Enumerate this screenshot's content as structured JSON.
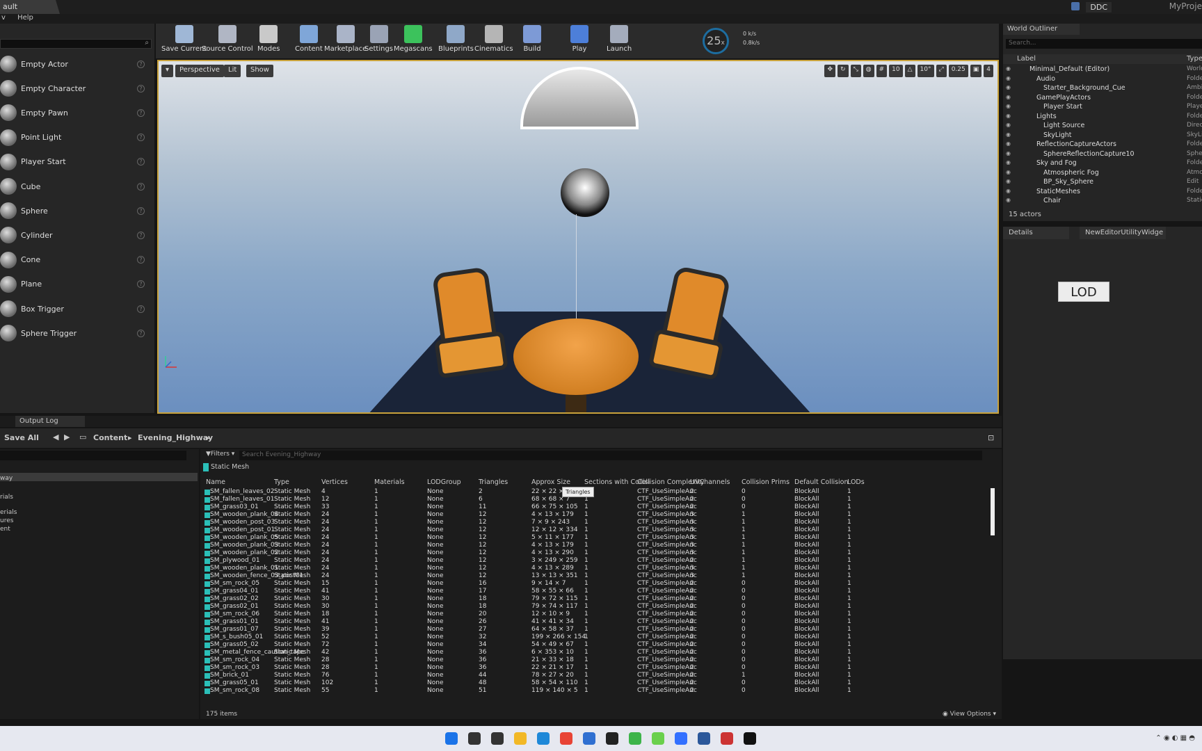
{
  "window": {
    "title_tab": "ault",
    "ddc_label": "DDC",
    "project_name": "MyProje"
  },
  "menu": {
    "items": [
      "v",
      "Help"
    ]
  },
  "place_items": [
    {
      "label": "Empty Actor",
      "icon": "sphere-icon"
    },
    {
      "label": "Empty Character",
      "icon": "character-icon"
    },
    {
      "label": "Empty Pawn",
      "icon": "pawn-icon"
    },
    {
      "label": "Point Light",
      "icon": "bulb-icon"
    },
    {
      "label": "Player Start",
      "icon": "player-start-icon"
    },
    {
      "label": "Cube",
      "icon": "cube-icon"
    },
    {
      "label": "Sphere",
      "icon": "sphere-icon"
    },
    {
      "label": "Cylinder",
      "icon": "cylinder-icon"
    },
    {
      "label": "Cone",
      "icon": "cone-icon"
    },
    {
      "label": "Plane",
      "icon": "plane-icon"
    },
    {
      "label": "Box Trigger",
      "icon": "box-trigger-icon"
    },
    {
      "label": "Sphere Trigger",
      "icon": "sphere-trigger-icon"
    }
  ],
  "toolbar": {
    "buttons": [
      {
        "label": "Save Current",
        "color": "#9fb7d6"
      },
      {
        "label": "Source Control",
        "color": "#b0b6c4"
      },
      {
        "label": "Modes",
        "color": "#c9c9c9"
      },
      {
        "label": "Content",
        "color": "#7fa6d8"
      },
      {
        "label": "Marketplace",
        "color": "#aab4c8"
      },
      {
        "label": "Settings",
        "color": "#9aa3b5"
      },
      {
        "label": "Megascans",
        "color": "#3cc25c"
      },
      {
        "label": "Blueprints",
        "color": "#8fa8c8"
      },
      {
        "label": "Cinematics",
        "color": "#b5b5b5"
      },
      {
        "label": "Build",
        "color": "#7d9ad6"
      },
      {
        "label": "Play",
        "color": "#4d7fd9"
      },
      {
        "label": "Launch",
        "color": "#a4acbc"
      }
    ],
    "fps": "25",
    "fps_unit": "x",
    "net_down": "0 k/s",
    "net_up": "0.8k/s"
  },
  "viewport": {
    "menu_label": "▾",
    "perspective": "Perspective",
    "lit": "Lit",
    "show": "Show",
    "grid_snap": "10",
    "rot_snap": "10°",
    "scale_snap": "0.25",
    "cam_speed": "4"
  },
  "outliner": {
    "tab": "World Outliner",
    "search_placeholder": "Search...",
    "col_label": "Label",
    "col_type": "Type",
    "rows": [
      {
        "label": "Minimal_Default (Editor)",
        "type": "World",
        "indent": 0
      },
      {
        "label": "Audio",
        "type": "Folder",
        "indent": 1
      },
      {
        "label": "Starter_Background_Cue",
        "type": "Ambi",
        "indent": 2
      },
      {
        "label": "GamePlayActors",
        "type": "Folder",
        "indent": 1
      },
      {
        "label": "Player Start",
        "type": "Playe",
        "indent": 2
      },
      {
        "label": "Lights",
        "type": "Folder",
        "indent": 1
      },
      {
        "label": "Light Source",
        "type": "Direc",
        "indent": 2
      },
      {
        "label": "SkyLight",
        "type": "SkyLi",
        "indent": 2
      },
      {
        "label": "ReflectionCaptureActors",
        "type": "Folder",
        "indent": 1
      },
      {
        "label": "SphereReflectionCapture10",
        "type": "Sphe",
        "indent": 2
      },
      {
        "label": "Sky and Fog",
        "type": "Folder",
        "indent": 1
      },
      {
        "label": "Atmospheric Fog",
        "type": "Atmo",
        "indent": 2
      },
      {
        "label": "BP_Sky_Sphere",
        "type": "Edit",
        "indent": 2
      },
      {
        "label": "StaticMeshes",
        "type": "Folder",
        "indent": 1
      },
      {
        "label": "Chair",
        "type": "Static",
        "indent": 2
      }
    ],
    "actor_count": "15 actors"
  },
  "details": {
    "tab": "Details",
    "tab2": "NewEditorUtilityWidge",
    "lod_button": "LOD"
  },
  "bottom": {
    "output_log_tab": "Output Log",
    "save_all": "Save All",
    "breadcrumb": [
      "Content",
      "Evening_Highway"
    ],
    "filters": "Filters",
    "search_placeholder": "Search Evening_Highway",
    "static_mesh_filter": "Static Mesh",
    "left_tree": [
      "way",
      "rials",
      "erials",
      "ures",
      "ent"
    ],
    "tooltip": "Triangles",
    "items_count": "175 items",
    "view_options": "View Options"
  },
  "table": {
    "columns": [
      "Name",
      "Type",
      "Vertices",
      "Materials",
      "LODGroup",
      "Triangles",
      "Approx Size",
      "Sections with Collisi",
      "Collision Complexity",
      "UVChannels",
      "Collision Prims",
      "Default Collision",
      "LODs"
    ],
    "rows": [
      [
        "SM_fallen_leaves_02",
        "Static Mesh",
        "4",
        "1",
        "None",
        "2",
        "22 × 22 × 3",
        "1",
        "CTF_UseSimpleAnc",
        "2",
        "0",
        "BlockAll",
        "1"
      ],
      [
        "SM_fallen_leaves_01",
        "Static Mesh",
        "12",
        "1",
        "None",
        "6",
        "68 × 68 × 7",
        "1",
        "CTF_UseSimpleAnc",
        "2",
        "0",
        "BlockAll",
        "1"
      ],
      [
        "SM_grass03_01",
        "Static Mesh",
        "33",
        "1",
        "None",
        "11",
        "66 × 75 × 105",
        "1",
        "CTF_UseSimpleAnc",
        "2",
        "0",
        "BlockAll",
        "1"
      ],
      [
        "SM_wooden_plank_04",
        "Static Mesh",
        "24",
        "1",
        "None",
        "12",
        "4 × 13 × 179",
        "1",
        "CTF_UseSimpleAnc",
        "3",
        "1",
        "BlockAll",
        "1"
      ],
      [
        "SM_wooden_post_03",
        "Static Mesh",
        "24",
        "1",
        "None",
        "12",
        "7 × 9 × 243",
        "1",
        "CTF_UseSimpleAnc",
        "3",
        "1",
        "BlockAll",
        "1"
      ],
      [
        "SM_wooden_post_01",
        "Static Mesh",
        "24",
        "1",
        "None",
        "12",
        "12 × 12 × 334",
        "1",
        "CTF_UseSimpleAnc",
        "3",
        "1",
        "BlockAll",
        "1"
      ],
      [
        "SM_wooden_plank_05",
        "Static Mesh",
        "24",
        "1",
        "None",
        "12",
        "5 × 11 × 177",
        "1",
        "CTF_UseSimpleAnc",
        "3",
        "1",
        "BlockAll",
        "1"
      ],
      [
        "SM_wooden_plank_03",
        "Static Mesh",
        "24",
        "1",
        "None",
        "12",
        "4 × 13 × 179",
        "1",
        "CTF_UseSimpleAnc",
        "3",
        "1",
        "BlockAll",
        "1"
      ],
      [
        "SM_wooden_plank_02",
        "Static Mesh",
        "24",
        "1",
        "None",
        "12",
        "4 × 13 × 290",
        "1",
        "CTF_UseSimpleAnc",
        "3",
        "1",
        "BlockAll",
        "1"
      ],
      [
        "SM_plywood_01",
        "Static Mesh",
        "24",
        "1",
        "None",
        "12",
        "3 × 249 × 259",
        "1",
        "CTF_UseSimpleAnc",
        "2",
        "1",
        "BlockAll",
        "1"
      ],
      [
        "SM_wooden_plank_01",
        "Static Mesh",
        "24",
        "1",
        "None",
        "12",
        "4 × 13 × 289",
        "1",
        "CTF_UseSimpleAnc",
        "3",
        "1",
        "BlockAll",
        "1"
      ],
      [
        "SM_wooden_fence_03_post01",
        "Static Mesh",
        "24",
        "1",
        "None",
        "12",
        "13 × 13 × 351",
        "1",
        "CTF_UseSimpleAnc",
        "3",
        "1",
        "BlockAll",
        "1"
      ],
      [
        "SM_sm_rock_05",
        "Static Mesh",
        "15",
        "1",
        "None",
        "16",
        "9 × 14 × 7",
        "1",
        "CTF_UseSimpleAnc",
        "2",
        "0",
        "BlockAll",
        "1"
      ],
      [
        "SM_grass04_01",
        "Static Mesh",
        "41",
        "1",
        "None",
        "17",
        "58 × 55 × 66",
        "1",
        "CTF_UseSimpleAnc",
        "2",
        "0",
        "BlockAll",
        "1"
      ],
      [
        "SM_grass02_02",
        "Static Mesh",
        "30",
        "1",
        "None",
        "18",
        "79 × 72 × 115",
        "1",
        "CTF_UseSimpleAnc",
        "2",
        "0",
        "BlockAll",
        "1"
      ],
      [
        "SM_grass02_01",
        "Static Mesh",
        "30",
        "1",
        "None",
        "18",
        "79 × 74 × 117",
        "1",
        "CTF_UseSimpleAnc",
        "2",
        "0",
        "BlockAll",
        "1"
      ],
      [
        "SM_sm_rock_06",
        "Static Mesh",
        "18",
        "1",
        "None",
        "20",
        "12 × 10 × 9",
        "1",
        "CTF_UseSimpleAnc",
        "2",
        "0",
        "BlockAll",
        "1"
      ],
      [
        "SM_grass01_01",
        "Static Mesh",
        "41",
        "1",
        "None",
        "26",
        "41 × 41 × 34",
        "1",
        "CTF_UseSimpleAnc",
        "2",
        "0",
        "BlockAll",
        "1"
      ],
      [
        "SM_grass01_07",
        "Static Mesh",
        "39",
        "1",
        "None",
        "27",
        "64 × 58 × 37",
        "1",
        "CTF_UseSimpleAnc",
        "2",
        "0",
        "BlockAll",
        "1"
      ],
      [
        "SM_s_bush05_01",
        "Static Mesh",
        "52",
        "1",
        "None",
        "32",
        "199 × 266 × 154",
        "1",
        "CTF_UseSimpleAnc",
        "2",
        "0",
        "BlockAll",
        "1"
      ],
      [
        "SM_grass05_02",
        "Static Mesh",
        "72",
        "1",
        "None",
        "34",
        "54 × 49 × 67",
        "1",
        "CTF_UseSimpleAnc",
        "2",
        "0",
        "BlockAll",
        "1"
      ],
      [
        "SM_metal_fence_caution_tape",
        "Static Mesh",
        "42",
        "1",
        "None",
        "36",
        "6 × 353 × 10",
        "1",
        "CTF_UseSimpleAnc",
        "2",
        "0",
        "BlockAll",
        "1"
      ],
      [
        "SM_sm_rock_04",
        "Static Mesh",
        "28",
        "1",
        "None",
        "36",
        "21 × 33 × 18",
        "1",
        "CTF_UseSimpleAnc",
        "2",
        "0",
        "BlockAll",
        "1"
      ],
      [
        "SM_sm_rock_03",
        "Static Mesh",
        "28",
        "1",
        "None",
        "36",
        "22 × 21 × 17",
        "1",
        "CTF_UseSimpleAnc",
        "2",
        "0",
        "BlockAll",
        "1"
      ],
      [
        "SM_brick_01",
        "Static Mesh",
        "76",
        "1",
        "None",
        "44",
        "78 × 27 × 20",
        "1",
        "CTF_UseSimpleAnc",
        "2",
        "1",
        "BlockAll",
        "1"
      ],
      [
        "SM_grass05_01",
        "Static Mesh",
        "102",
        "1",
        "None",
        "48",
        "58 × 54 × 110",
        "1",
        "CTF_UseSimpleAnc",
        "2",
        "0",
        "BlockAll",
        "1"
      ],
      [
        "SM_sm_rock_08",
        "Static Mesh",
        "55",
        "1",
        "None",
        "51",
        "119 × 140 × 5",
        "1",
        "CTF_UseSimpleAnc",
        "2",
        "0",
        "BlockAll",
        "1"
      ]
    ]
  },
  "taskbar": {
    "icons": [
      "windows-start-icon",
      "search-icon",
      "task-view-icon",
      "file-explorer-icon",
      "edge-icon",
      "chrome-icon",
      "store-icon",
      "epic-games-icon",
      "wechat-icon",
      "green-app-icon",
      "feishu-icon",
      "word-icon",
      "app-icon",
      "unreal-icon"
    ]
  }
}
